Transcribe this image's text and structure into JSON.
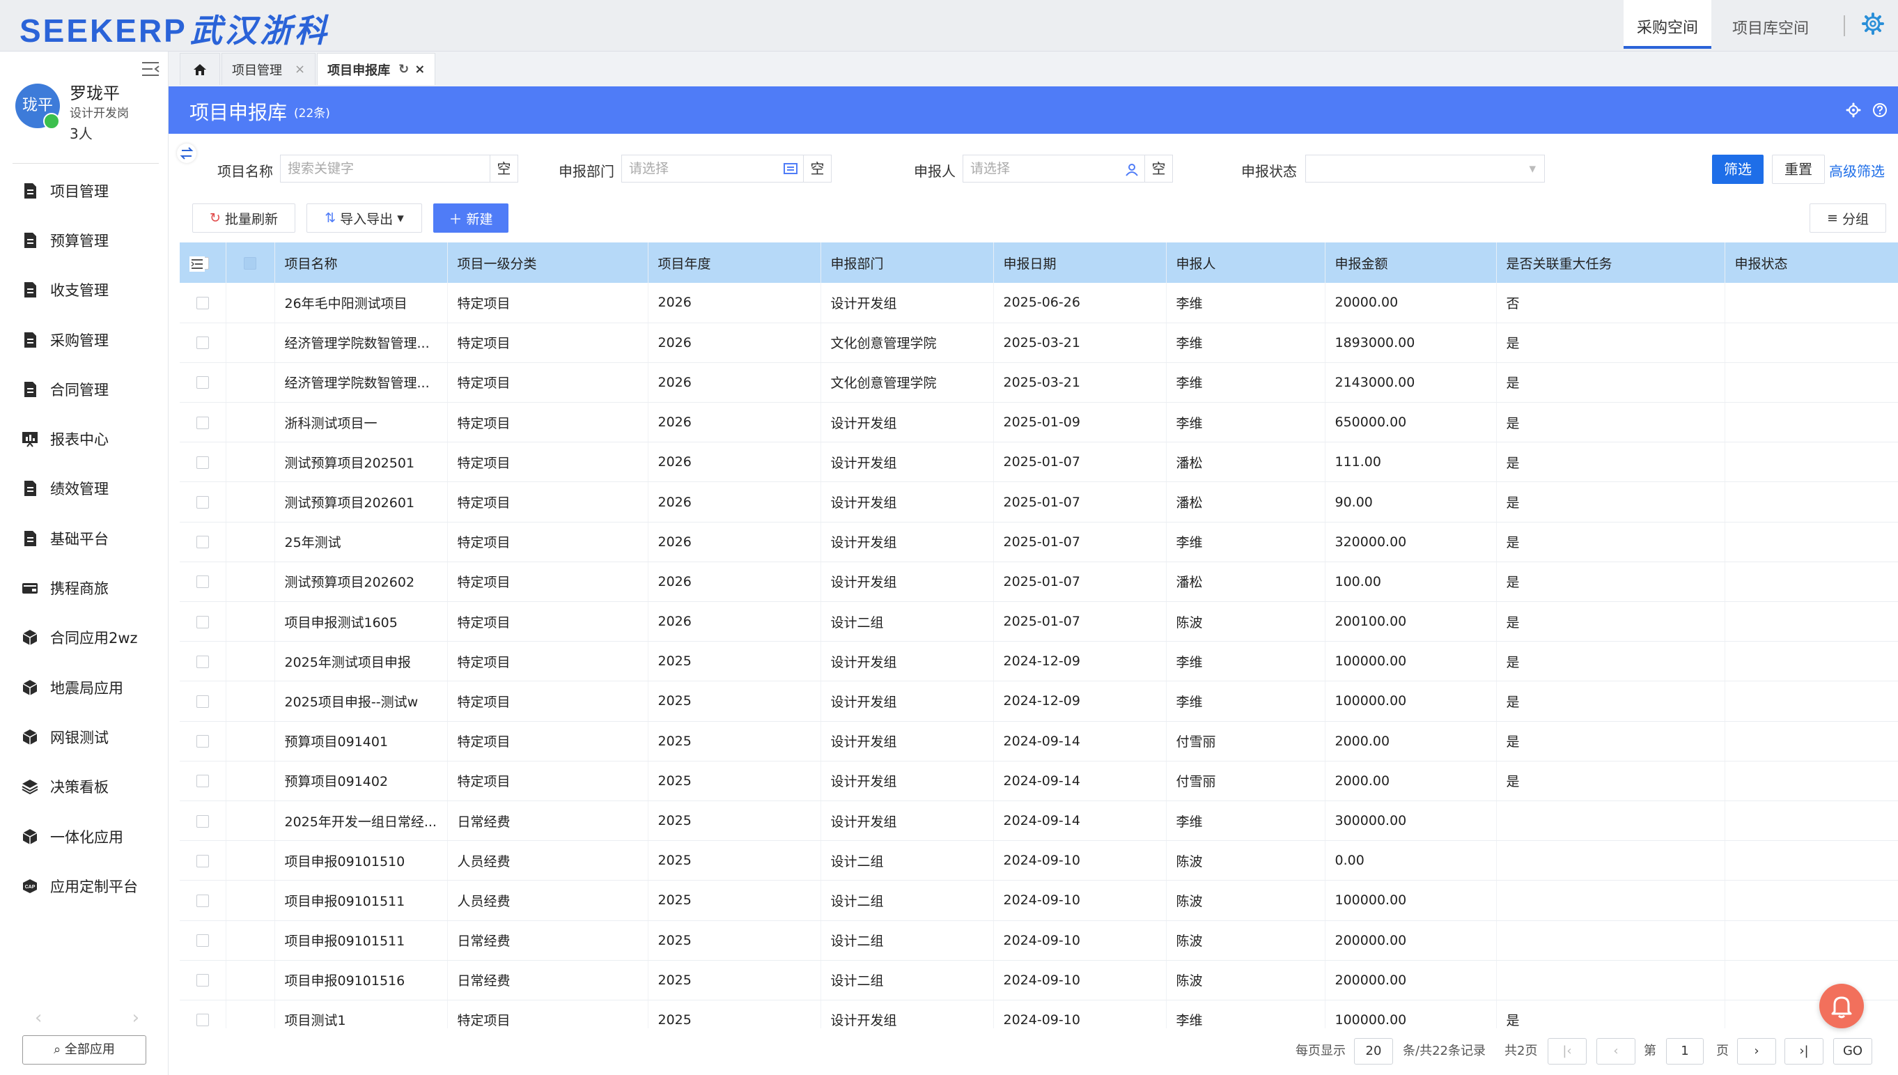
{
  "brand": {
    "name": "SEEKERP",
    "city_name": "武汉浙科"
  },
  "top_spaces": [
    {
      "label": "采购空间",
      "active": true
    },
    {
      "label": "项目库空间",
      "active": false
    }
  ],
  "user": {
    "avatar_text": "珑平",
    "name": "罗珑平",
    "role": "设计开发岗",
    "count": "3人"
  },
  "sidebar": {
    "items": [
      {
        "label": "项目管理",
        "icon": "document-icon"
      },
      {
        "label": "预算管理",
        "icon": "document-icon"
      },
      {
        "label": "收支管理",
        "icon": "document-icon"
      },
      {
        "label": "采购管理",
        "icon": "document-icon"
      },
      {
        "label": "合同管理",
        "icon": "document-icon"
      },
      {
        "label": "报表中心",
        "icon": "report-icon"
      },
      {
        "label": "绩效管理",
        "icon": "document-icon"
      },
      {
        "label": "基础平台",
        "icon": "document-icon"
      },
      {
        "label": "携程商旅",
        "icon": "wallet-icon"
      },
      {
        "label": "合同应用2wz",
        "icon": "cube-icon"
      },
      {
        "label": "地震局应用",
        "icon": "cube-icon"
      },
      {
        "label": "网银测试",
        "icon": "cube-icon"
      },
      {
        "label": "决策看板",
        "icon": "layers-icon"
      },
      {
        "label": "一体化应用",
        "icon": "cube-icon"
      },
      {
        "label": "应用定制平台",
        "icon": "cap-icon"
      }
    ],
    "all_apps_label": "全部应用"
  },
  "tabs": [
    {
      "label": "项目管理",
      "active": false
    },
    {
      "label": "项目申报库",
      "active": true
    }
  ],
  "page": {
    "title": "项目申报库",
    "count": "(22条)"
  },
  "filters": {
    "name_label": "项目名称",
    "name_placeholder": "搜索关键字",
    "dept_label": "申报部门",
    "dept_placeholder": "请选择",
    "applicant_label": "申报人",
    "applicant_placeholder": "请选择",
    "status_label": "申报状态",
    "clear_label": "空",
    "filter_button": "筛选",
    "reset_button": "重置",
    "advanced_link": "高级筛选"
  },
  "toolbar": {
    "batch_refresh": "批量刷新",
    "import_export": "导入导出",
    "new": "新建",
    "group": "分组"
  },
  "table": {
    "columns": [
      "项目名称",
      "项目一级分类",
      "项目年度",
      "申报部门",
      "申报日期",
      "申报人",
      "申报金额",
      "是否关联重大任务",
      "申报状态"
    ],
    "rows": [
      [
        "26年毛中阳测试项目",
        "特定项目",
        "2026",
        "设计开发组",
        "2025-06-26",
        "李维",
        "20000.00",
        "否",
        ""
      ],
      [
        "经济管理学院数智管理...",
        "特定项目",
        "2026",
        "文化创意管理学院",
        "2025-03-21",
        "李维",
        "1893000.00",
        "是",
        ""
      ],
      [
        "经济管理学院数智管理...",
        "特定项目",
        "2026",
        "文化创意管理学院",
        "2025-03-21",
        "李维",
        "2143000.00",
        "是",
        ""
      ],
      [
        "浙科测试项目一",
        "特定项目",
        "2026",
        "设计开发组",
        "2025-01-09",
        "李维",
        "650000.00",
        "是",
        ""
      ],
      [
        "测试预算项目202501",
        "特定项目",
        "2026",
        "设计开发组",
        "2025-01-07",
        "潘松",
        "111.00",
        "是",
        ""
      ],
      [
        "测试预算项目202601",
        "特定项目",
        "2026",
        "设计开发组",
        "2025-01-07",
        "潘松",
        "90.00",
        "是",
        ""
      ],
      [
        "25年测试",
        "特定项目",
        "2026",
        "设计开发组",
        "2025-01-07",
        "李维",
        "320000.00",
        "是",
        ""
      ],
      [
        "测试预算项目202602",
        "特定项目",
        "2026",
        "设计开发组",
        "2025-01-07",
        "潘松",
        "100.00",
        "是",
        ""
      ],
      [
        "项目申报测试1605",
        "特定项目",
        "2026",
        "设计二组",
        "2025-01-07",
        "陈波",
        "200100.00",
        "是",
        ""
      ],
      [
        "2025年测试项目申报",
        "特定项目",
        "2025",
        "设计开发组",
        "2024-12-09",
        "李维",
        "100000.00",
        "是",
        ""
      ],
      [
        "2025项目申报--测试w",
        "特定项目",
        "2025",
        "设计开发组",
        "2024-12-09",
        "李维",
        "100000.00",
        "是",
        ""
      ],
      [
        "预算项目091401",
        "特定项目",
        "2025",
        "设计开发组",
        "2024-09-14",
        "付雪丽",
        "2000.00",
        "是",
        ""
      ],
      [
        "预算项目091402",
        "特定项目",
        "2025",
        "设计开发组",
        "2024-09-14",
        "付雪丽",
        "2000.00",
        "是",
        ""
      ],
      [
        "2025年开发一组日常经...",
        "日常经费",
        "2025",
        "设计开发组",
        "2024-09-14",
        "李维",
        "300000.00",
        "",
        ""
      ],
      [
        "项目申报09101510",
        "人员经费",
        "2025",
        "设计二组",
        "2024-09-10",
        "陈波",
        "0.00",
        "",
        ""
      ],
      [
        "项目申报09101511",
        "人员经费",
        "2025",
        "设计二组",
        "2024-09-10",
        "陈波",
        "100000.00",
        "",
        ""
      ],
      [
        "项目申报09101511",
        "日常经费",
        "2025",
        "设计二组",
        "2024-09-10",
        "陈波",
        "200000.00",
        "",
        ""
      ],
      [
        "项目申报09101516",
        "日常经费",
        "2025",
        "设计二组",
        "2024-09-10",
        "陈波",
        "200000.00",
        "",
        ""
      ],
      [
        "项目测试1",
        "特定项目",
        "2025",
        "设计开发组",
        "2024-09-10",
        "李维",
        "100000.00",
        "是",
        ""
      ]
    ]
  },
  "pagination": {
    "per_page_label": "每页显示",
    "per_page": "20",
    "records_label": "条/共22条记录",
    "pages_label": "共2页",
    "page_prefix": "第",
    "current_page": "1",
    "page_suffix": "页",
    "go_label": "GO"
  },
  "colors": {
    "primary": "#4f7cf7",
    "header_row": "#b6d9f8",
    "brand": "#2a63d8",
    "bell": "#f2705c"
  }
}
